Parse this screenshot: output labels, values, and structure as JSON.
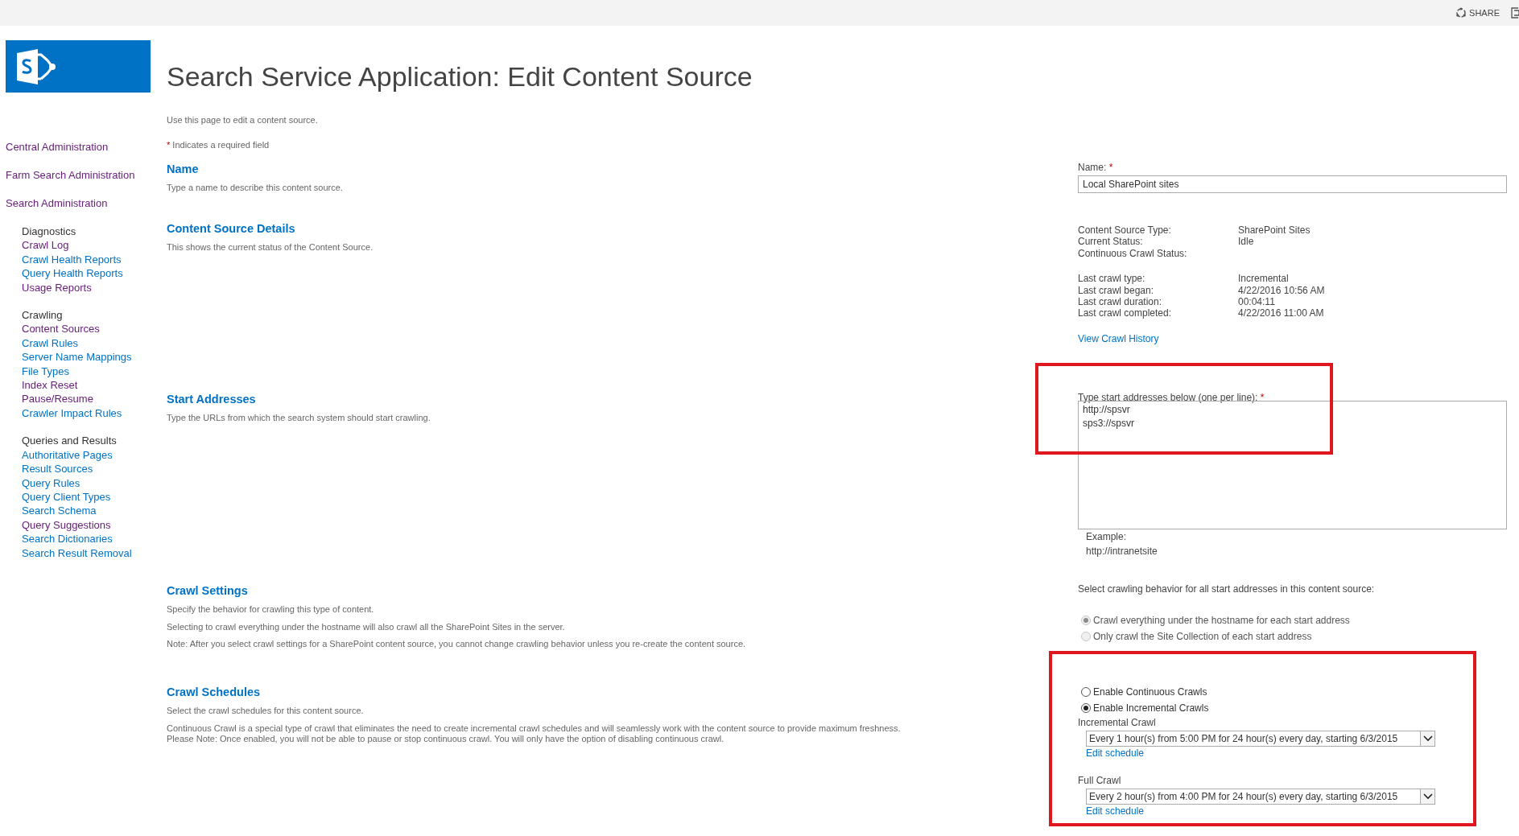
{
  "top_bar": {
    "share_label": "SHARE"
  },
  "page_title": "Search Service Application: Edit Content Source",
  "intro": "Use this page to edit a content source.",
  "required_note": {
    "mark": "*",
    "text": "Indicates a required field"
  },
  "nav": {
    "top_links": [
      {
        "label": "Central Administration",
        "visited": true
      },
      {
        "label": "Farm Search Administration",
        "visited": true
      },
      {
        "label": "Search Administration",
        "visited": true
      }
    ],
    "groups": [
      {
        "heading": "Diagnostics",
        "links": [
          {
            "label": "Crawl Log",
            "visited": true
          },
          {
            "label": "Crawl Health Reports",
            "visited": false
          },
          {
            "label": "Query Health Reports",
            "visited": false
          },
          {
            "label": "Usage Reports",
            "visited": true
          }
        ]
      },
      {
        "heading": "Crawling",
        "links": [
          {
            "label": "Content Sources",
            "visited": true
          },
          {
            "label": "Crawl Rules",
            "visited": false
          },
          {
            "label": "Server Name Mappings",
            "visited": false
          },
          {
            "label": "File Types",
            "visited": false
          },
          {
            "label": "Index Reset",
            "visited": true
          },
          {
            "label": "Pause/Resume",
            "visited": true
          },
          {
            "label": "Crawler Impact Rules",
            "visited": false
          }
        ]
      },
      {
        "heading": "Queries and Results",
        "links": [
          {
            "label": "Authoritative Pages",
            "visited": false
          },
          {
            "label": "Result Sources",
            "visited": false
          },
          {
            "label": "Query Rules",
            "visited": false
          },
          {
            "label": "Query Client Types",
            "visited": false
          },
          {
            "label": "Search Schema",
            "visited": false
          },
          {
            "label": "Query Suggestions",
            "visited": true
          },
          {
            "label": "Search Dictionaries",
            "visited": false
          },
          {
            "label": "Search Result Removal",
            "visited": false
          }
        ]
      }
    ]
  },
  "sections": [
    {
      "kind": "name",
      "heading": "Name",
      "paragraphs": [
        [
          "Type a name to describe this content source."
        ]
      ],
      "field_label": "Name:",
      "required_mark": "*",
      "value": "Local SharePoint sites"
    },
    {
      "kind": "details",
      "heading": "Content Source Details",
      "paragraphs": [
        [
          "This shows the current status of the Content Source."
        ]
      ],
      "groups": [
        [
          {
            "label": "Content Source Type:",
            "value": "SharePoint Sites"
          },
          {
            "label": "Current Status:",
            "value": "Idle"
          },
          {
            "label": "Continuous Crawl Status:"
          }
        ],
        [
          {
            "label": "Last crawl type:",
            "value": "Incremental"
          },
          {
            "label": "Last crawl began:",
            "value": "4/22/2016 10:56 AM"
          },
          {
            "label": "Last crawl duration:",
            "value": "00:04:11"
          },
          {
            "label": "Last crawl completed:",
            "value": "4/22/2016 11:00 AM"
          }
        ]
      ],
      "link": "View Crawl History"
    },
    {
      "kind": "addresses",
      "heading": "Start Addresses",
      "paragraphs": [
        [
          "Type the URLs from which the search system should start crawling."
        ]
      ],
      "field_label": "Type start addresses below (one per line):",
      "required_mark": "*",
      "value": "http://spsvr\nsps3://spsvr",
      "example_label": "Example:",
      "example": "http://intranetsite",
      "highlighted": true
    },
    {
      "kind": "settings",
      "heading": "Crawl Settings",
      "paragraphs": [
        [
          "Specify the behavior for crawling this type of content."
        ],
        [
          "Selecting to crawl everything under the hostname will also crawl all the SharePoint Sites in the server."
        ],
        [
          "Note: After you select crawl settings for a SharePoint content source, you cannot change crawling behavior unless you re-create the content source."
        ]
      ],
      "prompt": "Select crawling behavior for all start addresses in this content source:",
      "options": [
        {
          "label": "Crawl everything under the hostname for each start address",
          "selected": true,
          "disabled": true
        },
        {
          "label": "Only crawl the Site Collection of each start address",
          "selected": false,
          "disabled": true
        }
      ]
    },
    {
      "kind": "schedules",
      "heading": "Crawl Schedules",
      "paragraphs": [
        [
          "Select the crawl schedules for this content source."
        ],
        [
          "Continuous Crawl is a special type of crawl that eliminates the need to create incremental crawl schedules and will seamlessly work with the content source to provide maximum freshness.",
          "Please Note: Once enabled, you will not be able to pause or stop continuous crawl. You will only have the option of disabling continuous crawl."
        ]
      ],
      "highlighted": true,
      "options": [
        {
          "label": "Enable Continuous Crawls",
          "selected": false,
          "disabled": false
        },
        {
          "label": "Enable Incremental Crawls",
          "selected": true,
          "disabled": false
        }
      ],
      "schedules": [
        {
          "label": "Incremental Crawl",
          "value": "Every 1 hour(s) from 5:00 PM for 24 hour(s) every day, starting 6/3/2015",
          "link": "Edit schedule"
        },
        {
          "label": "Full Crawl",
          "value": "Every 2 hour(s) from 4:00 PM for 24 hour(s) every day, starting 6/3/2015",
          "link": "Edit schedule"
        }
      ]
    }
  ]
}
